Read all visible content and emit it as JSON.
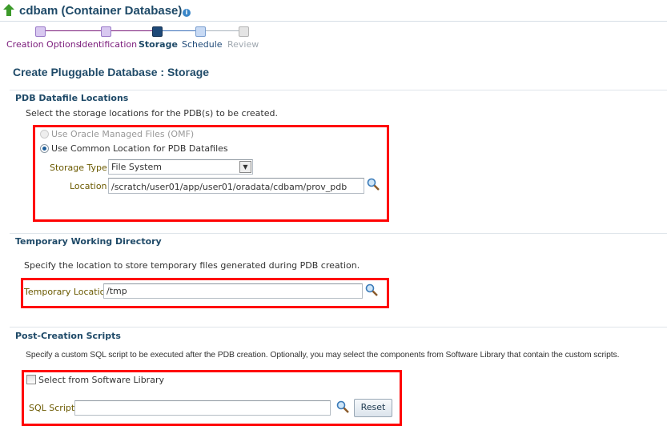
{
  "header": {
    "title": "cdbam (Container Database)",
    "icons": [
      "up-arrow-icon",
      "info-icon"
    ]
  },
  "train": {
    "steps": [
      {
        "label": "Creation Options",
        "state": "visited"
      },
      {
        "label": "Identification",
        "state": "visited"
      },
      {
        "label": "Storage",
        "state": "current"
      },
      {
        "label": "Schedule",
        "state": "next"
      },
      {
        "label": "Review",
        "state": "disabled"
      }
    ]
  },
  "page_title": "Create Pluggable Database : Storage",
  "datafile": {
    "heading": "PDB Datafile Locations",
    "description": "Select the storage locations for the PDB(s) to be created.",
    "omf_label": "Use Oracle Managed Files (OMF)",
    "common_label": "Use Common Location for PDB Datafiles",
    "selected": "common",
    "storage_type_label": "Storage Type",
    "storage_type_value": "File System",
    "location_label": "Location",
    "location_value": "/scratch/user01/app/user01/oradata/cdbam/prov_pdb"
  },
  "tempdir": {
    "heading": "Temporary Working Directory",
    "description": "Specify the location to store temporary files generated during PDB creation.",
    "label": "Temporary Location",
    "value": "/tmp"
  },
  "scripts": {
    "heading": "Post-Creation Scripts",
    "description": "Specify a custom SQL script to be executed after the PDB creation. Optionally, you may select the components from Software Library that contain the custom scripts.",
    "checkbox_label": "Select from Software Library",
    "checked": false,
    "sql_label": "SQL Script",
    "sql_value": "",
    "reset_label": "Reset"
  },
  "colors": {
    "highlight": "#ff0000",
    "heading": "#1f4a68",
    "visited": "#7a1a7a",
    "current": "#1f4a68"
  }
}
